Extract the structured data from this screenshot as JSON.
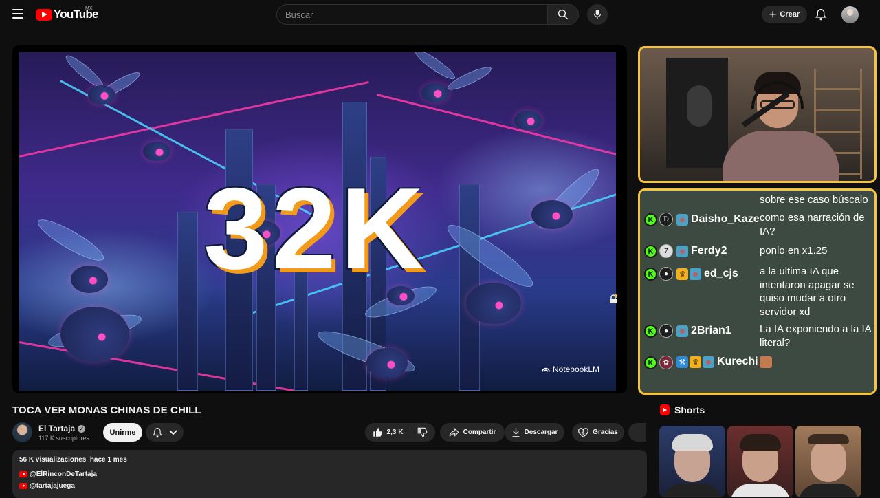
{
  "topbar": {
    "logo_text": "YouTube",
    "country_code": "MX",
    "search_placeholder": "Buscar",
    "create_label": "Crear"
  },
  "video": {
    "thumbnail_text": "32K",
    "watermark": "NotebookLM",
    "title": "TOCA VER MONAS CHINAS DE CHILL"
  },
  "channel": {
    "name": "El Tartaja",
    "subscribers": "117 K suscriptores",
    "join_label": "Unirme"
  },
  "actions": {
    "likes": "2,3 K",
    "share": "Compartir",
    "download": "Descargar",
    "thanks": "Gracias"
  },
  "description": {
    "meta": "56 K visualizaciones  hace 1 mes",
    "links": [
      "@ElRinconDeTartaja",
      "@tartajajuega"
    ]
  },
  "chat": {
    "messages": [
      {
        "user": "",
        "text": "sobre ese caso búscalo"
      },
      {
        "user": "Daisho_Kaze",
        "avatar": "D",
        "text": "como esa narración de IA?"
      },
      {
        "user": "Ferdy2",
        "avatar": "7",
        "text": "ponlo en x1.25"
      },
      {
        "user": "ed_cjs",
        "avatar": "person",
        "text": "a la ultima IA que intentaron apagar se quiso mudar a otro servidor xd"
      },
      {
        "user": "2Brian1",
        "avatar": "person",
        "text": "La IA exponiendo a la IA literal?"
      },
      {
        "user": "Kurechi",
        "avatar": "K",
        "text": ""
      }
    ]
  },
  "shorts": {
    "heading": "Shorts"
  },
  "colors": {
    "accent_red": "#ff0000",
    "overlay_border": "#f7c23c",
    "kick_green": "#53fc18",
    "chat_bg": "#3d4a41"
  }
}
